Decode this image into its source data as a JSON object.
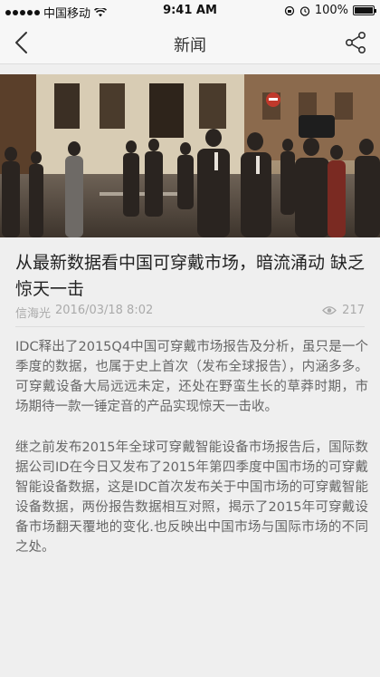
{
  "status_bar": {
    "carrier": "中国移动",
    "time": "9:41 AM",
    "battery": "100%"
  },
  "nav": {
    "title": "新闻"
  },
  "article": {
    "title": "从最新数据看中国可穿戴市场，暗流涌动 缺乏惊天一击",
    "author": "信海光",
    "date": "2016/03/18 8:02",
    "views": "217",
    "paragraphs": [
      "IDC释出了2015Q4中国可穿戴市场报告及分析，虽只是一个季度的数据，也属于史上首次（发布全球报告），内涵多多。可穿戴设备大局远远未定，还处在野蛮生长的草莽时期，市场期待一款一锤定音的产品实现惊天一击收。",
      "继之前发布2015年全球可穿戴智能设备市场报告后，国际数据公司ID在今日又发布了2015年第四季度中国市场的可穿戴智能设备数据，这是IDC首次发布关于中国市场的可穿戴智能设备数据，两份报告数据相互对照，揭示了2015年可穿戴设备市场翻天覆地的变化.也反映出中国市场与国际市场的不同之处。"
    ]
  },
  "colors": {
    "background": "#efefef",
    "nav_background": "#f7f7f7",
    "text_primary": "#222222",
    "text_secondary": "#666666",
    "text_meta": "#aaaaaa"
  },
  "icons": {
    "back": "chevron-left-icon",
    "share": "share-icon",
    "views": "eye-icon"
  }
}
